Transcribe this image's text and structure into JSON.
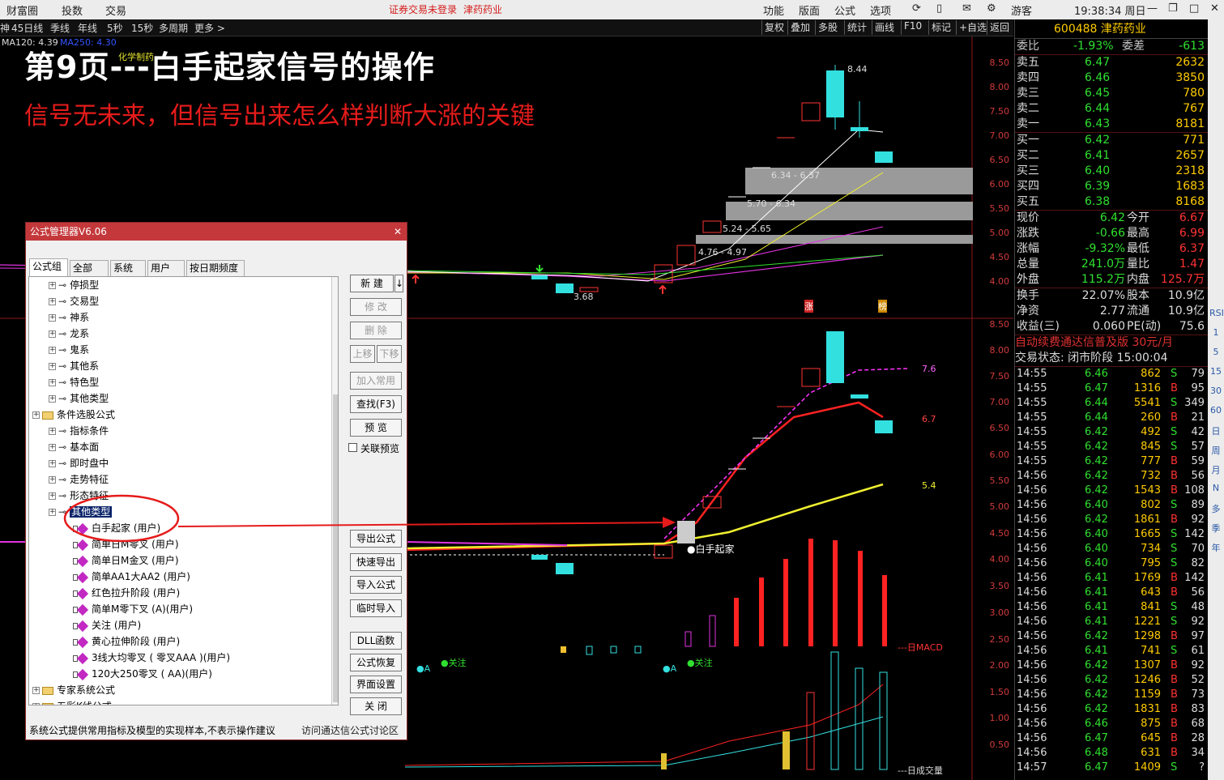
{
  "menubar": {
    "left": [
      "财富圈",
      "投数",
      "交易"
    ],
    "warning": "证券交易未登录",
    "stock_name_top": "津药药业",
    "right": [
      "功能",
      "版面",
      "公式",
      "选项"
    ],
    "user": "游客",
    "clock": "19:38:34 周日"
  },
  "period_bar": {
    "items": [
      "45日线",
      "季线",
      "年线",
      "5秒",
      "15秒",
      "多周期",
      "更多 >"
    ],
    "right": [
      "复权",
      "叠加",
      "多股",
      "统计",
      "画线",
      "F10",
      "标记",
      "+自选",
      "返回"
    ]
  },
  "ma_legend": {
    "ma120": "MA120: 4.39",
    "ma250": "MA250: 4.30",
    "extra": "化学制药"
  },
  "overlay": {
    "title": "第9页---白手起家信号的操作",
    "subtitle": "信号无未来，但信号出来怎么样判断大涨的关键"
  },
  "chart_labels": {
    "high": "8.44",
    "low": "3.68",
    "zones": [
      "6.34 - 6.37",
      "5.70 - 6.34",
      "5.24 - 5.65",
      "4.76 - 4.97"
    ],
    "marks": [
      "涨",
      "榜"
    ],
    "lines_right": [
      "7.6",
      "6.7",
      "5.4"
    ],
    "signal": "●白手起家",
    "guanzhu": "●关注",
    "a_mark": "●A",
    "macd": "---日MACD",
    "volume": "---日成交量"
  },
  "axis_top": [
    "8.50",
    "8.00",
    "7.50",
    "7.00",
    "6.50",
    "6.00",
    "5.50",
    "5.00",
    "4.50",
    "4.00"
  ],
  "axis_bottom": [
    "8.50",
    "8.00",
    "7.50",
    "7.00",
    "6.50",
    "6.00",
    "5.50",
    "5.00",
    "4.50",
    "4.00",
    "3.50",
    "3.00",
    "2.50",
    "2.00",
    "1.50",
    "1.00",
    "0.50"
  ],
  "quote": {
    "code_name": "600488 津药药业",
    "weibi": [
      "委比",
      "-1.93%",
      "委差",
      "-613"
    ],
    "sells": [
      [
        "卖五",
        "6.47",
        "2632"
      ],
      [
        "卖四",
        "6.46",
        "3850"
      ],
      [
        "卖三",
        "6.45",
        "780"
      ],
      [
        "卖二",
        "6.44",
        "767"
      ],
      [
        "卖一",
        "6.43",
        "8181"
      ]
    ],
    "buys": [
      [
        "买一",
        "6.42",
        "771"
      ],
      [
        "买二",
        "6.41",
        "2657"
      ],
      [
        "买三",
        "6.40",
        "2318"
      ],
      [
        "买四",
        "6.39",
        "1683"
      ],
      [
        "买五",
        "6.38",
        "8168"
      ]
    ],
    "stats": [
      [
        "现价",
        "6.42",
        "今开",
        "6.67"
      ],
      [
        "涨跌",
        "-0.66",
        "最高",
        "6.99"
      ],
      [
        "涨幅",
        "-9.32%",
        "最低",
        "6.37"
      ],
      [
        "总量",
        "241.0万",
        "量比",
        "1.47"
      ],
      [
        "外盘",
        "115.2万",
        "内盘",
        "125.7万"
      ]
    ],
    "stats2": [
      [
        "换手",
        "22.07%",
        "股本",
        "10.9亿"
      ],
      [
        "净资",
        "2.77",
        "流通",
        "10.9亿"
      ],
      [
        "收益(三)",
        "0.060",
        "PE(动)",
        "75.6"
      ]
    ],
    "ad": "自动续费通达信普及版  30元/月",
    "state": "交易状态: 闭市阶段 15:00:04",
    "ticks": [
      [
        "14:55",
        "6.46",
        "862",
        "S",
        "79"
      ],
      [
        "14:55",
        "6.47",
        "1316",
        "B",
        "95"
      ],
      [
        "14:55",
        "6.44",
        "5541",
        "S",
        "349"
      ],
      [
        "14:55",
        "6.44",
        "260",
        "B",
        "21"
      ],
      [
        "14:55",
        "6.42",
        "492",
        "S",
        "42"
      ],
      [
        "14:55",
        "6.42",
        "845",
        "S",
        "57"
      ],
      [
        "14:55",
        "6.42",
        "777",
        "B",
        "59"
      ],
      [
        "14:56",
        "6.42",
        "732",
        "B",
        "56"
      ],
      [
        "14:56",
        "6.42",
        "1543",
        "B",
        "108"
      ],
      [
        "14:56",
        "6.40",
        "802",
        "S",
        "89"
      ],
      [
        "14:56",
        "6.42",
        "1861",
        "B",
        "92"
      ],
      [
        "14:56",
        "6.40",
        "1665",
        "S",
        "142"
      ],
      [
        "14:56",
        "6.40",
        "734",
        "S",
        "70"
      ],
      [
        "14:56",
        "6.40",
        "795",
        "S",
        "82"
      ],
      [
        "14:56",
        "6.41",
        "1769",
        "B",
        "142"
      ],
      [
        "14:56",
        "6.41",
        "643",
        "B",
        "56"
      ],
      [
        "14:56",
        "6.41",
        "841",
        "S",
        "48"
      ],
      [
        "14:56",
        "6.41",
        "1221",
        "S",
        "92"
      ],
      [
        "14:56",
        "6.42",
        "1298",
        "B",
        "97"
      ],
      [
        "14:56",
        "6.41",
        "741",
        "S",
        "61"
      ],
      [
        "14:56",
        "6.42",
        "1307",
        "B",
        "92"
      ],
      [
        "14:56",
        "6.42",
        "1246",
        "B",
        "52"
      ],
      [
        "14:56",
        "6.42",
        "1159",
        "B",
        "73"
      ],
      [
        "14:56",
        "6.42",
        "1831",
        "B",
        "83"
      ],
      [
        "14:56",
        "6.46",
        "875",
        "B",
        "68"
      ],
      [
        "14:56",
        "6.47",
        "645",
        "B",
        "28"
      ],
      [
        "14:56",
        "6.48",
        "631",
        "B",
        "34"
      ],
      [
        "14:57",
        "6.47",
        "1409",
        "S",
        "?"
      ]
    ]
  },
  "sidetools": [
    "RSI",
    "1",
    "5",
    "15",
    "30",
    "60",
    "日",
    "周",
    "月",
    "N",
    "多",
    "季",
    "年"
  ],
  "dialog": {
    "title": "公式管理器V6.06",
    "tabs": [
      "公式组",
      "全部",
      "系统",
      "用户",
      "按日期频度"
    ],
    "tree": [
      {
        "level": 2,
        "kind": "key",
        "label": "停损型"
      },
      {
        "level": 2,
        "kind": "key",
        "label": "交易型"
      },
      {
        "level": 2,
        "kind": "key",
        "label": "神系"
      },
      {
        "level": 2,
        "kind": "key",
        "label": "龙系"
      },
      {
        "level": 2,
        "kind": "key",
        "label": "鬼系"
      },
      {
        "level": 2,
        "kind": "key",
        "label": "其他系"
      },
      {
        "level": 2,
        "kind": "key",
        "label": "特色型"
      },
      {
        "level": 2,
        "kind": "key",
        "label": "其他类型"
      },
      {
        "level": 1,
        "kind": "folder",
        "label": "条件选股公式"
      },
      {
        "level": 2,
        "kind": "key",
        "label": "指标条件"
      },
      {
        "level": 2,
        "kind": "key",
        "label": "基本面"
      },
      {
        "level": 2,
        "kind": "key",
        "label": "即时盘中"
      },
      {
        "level": 2,
        "kind": "key",
        "label": "走势特征"
      },
      {
        "level": 2,
        "kind": "key",
        "label": "形态特征"
      },
      {
        "level": 2,
        "kind": "selected",
        "label": "其他类型"
      },
      {
        "level": 3,
        "kind": "formula",
        "label": "白手起家 (用户)"
      },
      {
        "level": 3,
        "kind": "formula",
        "label": "简单日M零叉 (用户)"
      },
      {
        "level": 3,
        "kind": "formula",
        "label": "简单日M金叉 (用户)"
      },
      {
        "level": 3,
        "kind": "formula",
        "label": "简单AA1大AA2 (用户)"
      },
      {
        "level": 3,
        "kind": "formula",
        "label": "红色拉升阶段 (用户)"
      },
      {
        "level": 3,
        "kind": "formula",
        "label": "简单M零下叉 (A)(用户)"
      },
      {
        "level": 3,
        "kind": "formula",
        "label": "关注 (用户)"
      },
      {
        "level": 3,
        "kind": "formula",
        "label": "黄心拉伸阶段 (用户)"
      },
      {
        "level": 3,
        "kind": "formula",
        "label": "3线大均零叉 ( 零叉AAA )(用户)"
      },
      {
        "level": 3,
        "kind": "formula",
        "label": "120大250零叉 ( AA)(用户)"
      },
      {
        "level": 1,
        "kind": "folder",
        "label": "专家系统公式"
      },
      {
        "level": 1,
        "kind": "folder",
        "label": "五彩K线公式"
      }
    ],
    "buttons": {
      "new": "新 建",
      "modify": "修 改",
      "delete": "删 除",
      "up": "上移",
      "down": "下移",
      "add_common": "加入常用",
      "find": "查找(F3)",
      "preview": "预 览",
      "link_preview": "关联预览",
      "export": "导出公式",
      "quick_export": "快速导出",
      "import": "导入公式",
      "temp_import": "临时导入",
      "dll": "DLL函数",
      "restore": "公式恢复",
      "ui_setting": "界面设置",
      "close": "关 闭"
    },
    "footer_left": "系统公式提供常用指标及模型的实现样本,不表示操作建议",
    "footer_right": "访问通达信公式讨论区"
  },
  "colors": {
    "up": "#ff3333",
    "down": "#33e0e0",
    "zone": "#9a9a9a",
    "title": "#ffffff",
    "sub": "#e51b1b"
  }
}
